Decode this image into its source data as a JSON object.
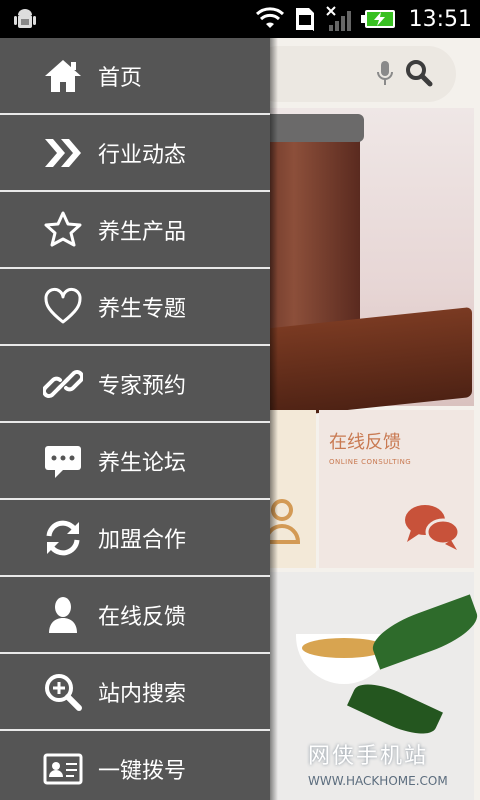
{
  "status_bar": {
    "time": "13:51",
    "icons": [
      "android-debug-icon",
      "wifi-icon",
      "sim-icon",
      "signal-icon",
      "battery-charging-icon"
    ]
  },
  "background_app": {
    "search": {
      "icons": [
        "mic-icon",
        "search-icon"
      ]
    },
    "tiles": {
      "feedback_title": "在线反馈",
      "feedback_subtitle": "ONLINE CONSULTING"
    },
    "watermark": {
      "brand": "网侠手机站",
      "url": "WWW.HACKHOME.COM"
    }
  },
  "drawer": {
    "items": [
      {
        "label": "首页",
        "icon": "home-icon"
      },
      {
        "label": "行业动态",
        "icon": "double-chevron-right-icon"
      },
      {
        "label": "养生产品",
        "icon": "star-outline-icon"
      },
      {
        "label": "养生专题",
        "icon": "heart-outline-icon"
      },
      {
        "label": "专家预约",
        "icon": "link-icon"
      },
      {
        "label": "养生论坛",
        "icon": "chat-bubble-icon"
      },
      {
        "label": "加盟合作",
        "icon": "refresh-icon"
      },
      {
        "label": "在线反馈",
        "icon": "person-icon"
      },
      {
        "label": "站内搜索",
        "icon": "zoom-in-icon"
      },
      {
        "label": "一键拨号",
        "icon": "contact-card-icon"
      }
    ]
  },
  "colors": {
    "drawer_bg": "#555555",
    "divider": "#e9e9e9",
    "icon": "#ffffff",
    "accent": "#c97a52"
  }
}
